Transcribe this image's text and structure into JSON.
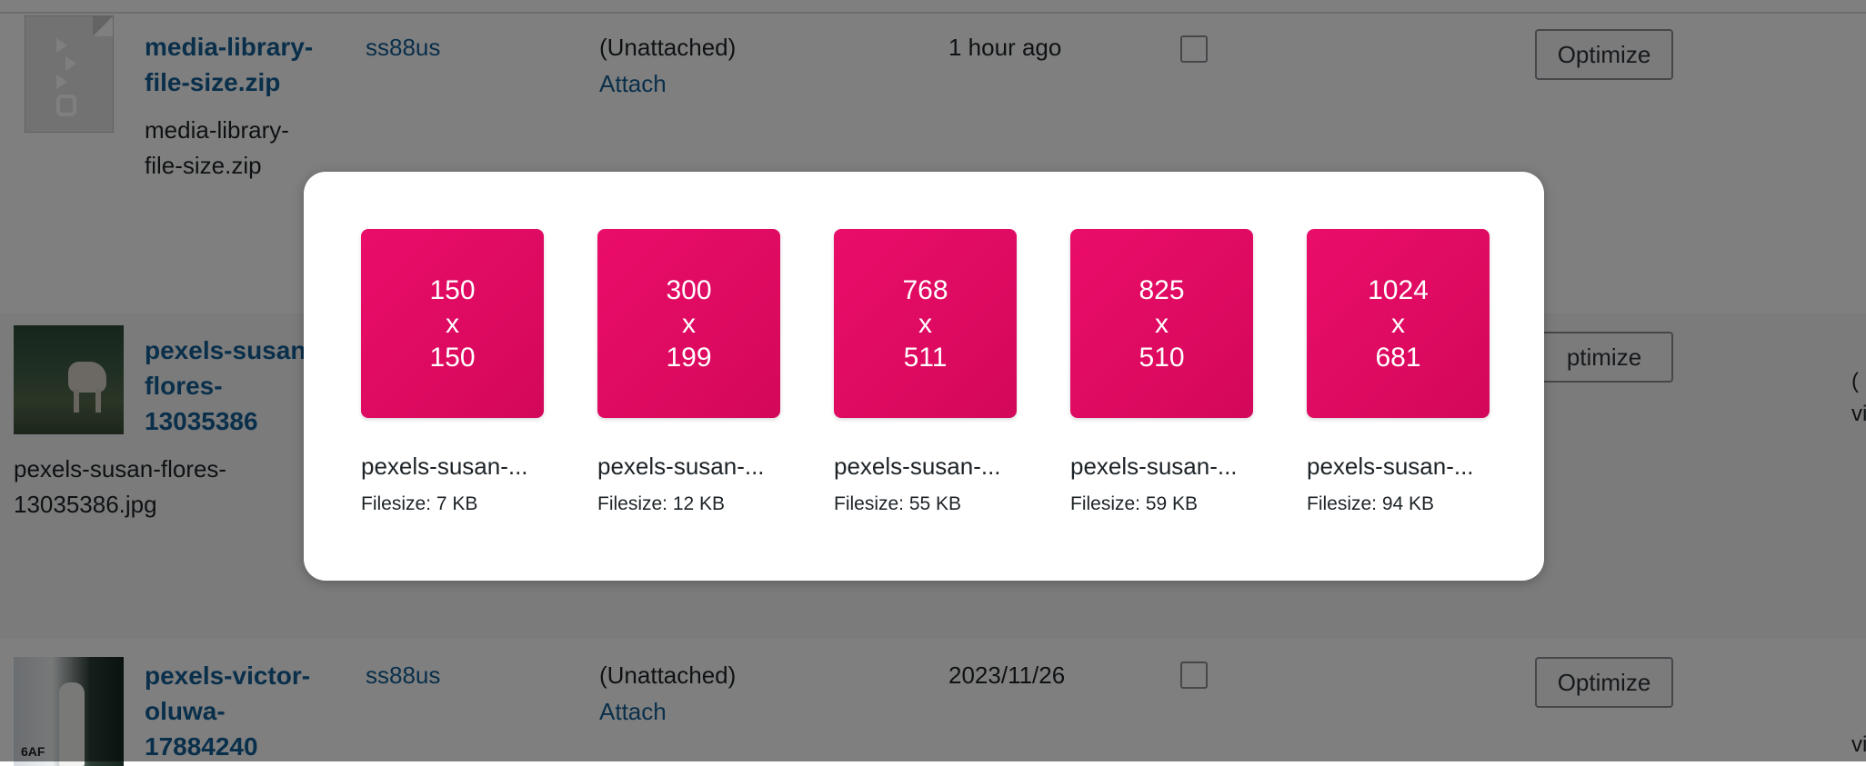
{
  "rows": [
    {
      "title_lines": [
        "media-library-",
        "file-size.zip"
      ],
      "filename_lines": [
        "media-library-",
        "file-size.zip"
      ],
      "author": "ss88us",
      "uploaded_to": "(Unattached)",
      "attach_label": "Attach",
      "date": "1 hour ago",
      "button_label": "Optimize"
    },
    {
      "title_lines": [
        "pexels-susan",
        "flores-",
        "13035386"
      ],
      "filename_lines": [
        "pexels-susan-flores-",
        "13035386.jpg"
      ],
      "button_label": "ptimize",
      "edge_lines": [
        "(",
        "vi"
      ]
    },
    {
      "title_lines": [
        "pexels-victor-",
        "oluwa-",
        "17884240"
      ],
      "author": "ss88us",
      "uploaded_to": "(Unattached)",
      "attach_label": "Attach",
      "date": "2023/11/26",
      "button_label": "Optimize",
      "edge_lines": [
        "",
        "vi"
      ],
      "thumb_sign": "6AF"
    }
  ],
  "modal": {
    "sizes": [
      {
        "w": "150",
        "x": "x",
        "h": "150",
        "name": "pexels-susan-...",
        "filesize": "Filesize: 7 KB"
      },
      {
        "w": "300",
        "x": "x",
        "h": "199",
        "name": "pexels-susan-...",
        "filesize": "Filesize: 12 KB"
      },
      {
        "w": "768",
        "x": "x",
        "h": "511",
        "name": "pexels-susan-...",
        "filesize": "Filesize: 55 KB"
      },
      {
        "w": "825",
        "x": "x",
        "h": "510",
        "name": "pexels-susan-...",
        "filesize": "Filesize: 59 KB"
      },
      {
        "w": "1024",
        "x": "x",
        "h": "681",
        "name": "pexels-susan-...",
        "filesize": "Filesize: 94 KB"
      }
    ]
  },
  "colors": {
    "accent_pink": "#e30b65",
    "link_blue": "#135e96",
    "overlay": "rgba(0,0,0,0.5)"
  }
}
